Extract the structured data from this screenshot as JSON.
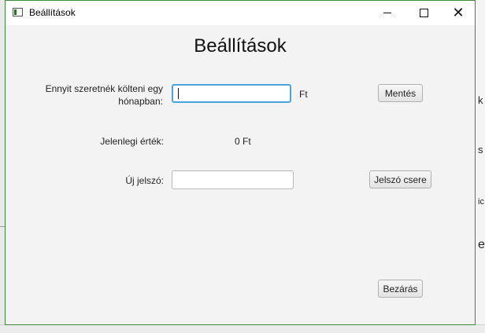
{
  "window": {
    "title": "Beállítások",
    "controls": {
      "minimize_icon": "minimize-icon",
      "maximize_icon": "maximize-icon",
      "close_icon": "close-icon",
      "close_glyph": "✕"
    }
  },
  "main": {
    "heading": "Beállítások",
    "budget_label": "Ennyit szeretnék költeni egy hónapban:",
    "budget_input_value": "",
    "currency_unit": "Ft",
    "save_button": "Mentés",
    "current_value_label": "Jelenlegi érték:",
    "current_value": "0 Ft",
    "new_password_label": "Új jelszó:",
    "new_password_value": "",
    "change_password_button": "Jelszó csere",
    "close_button": "Bezárás"
  },
  "background_fragments": [
    "k",
    "s",
    "ic",
    "e"
  ]
}
